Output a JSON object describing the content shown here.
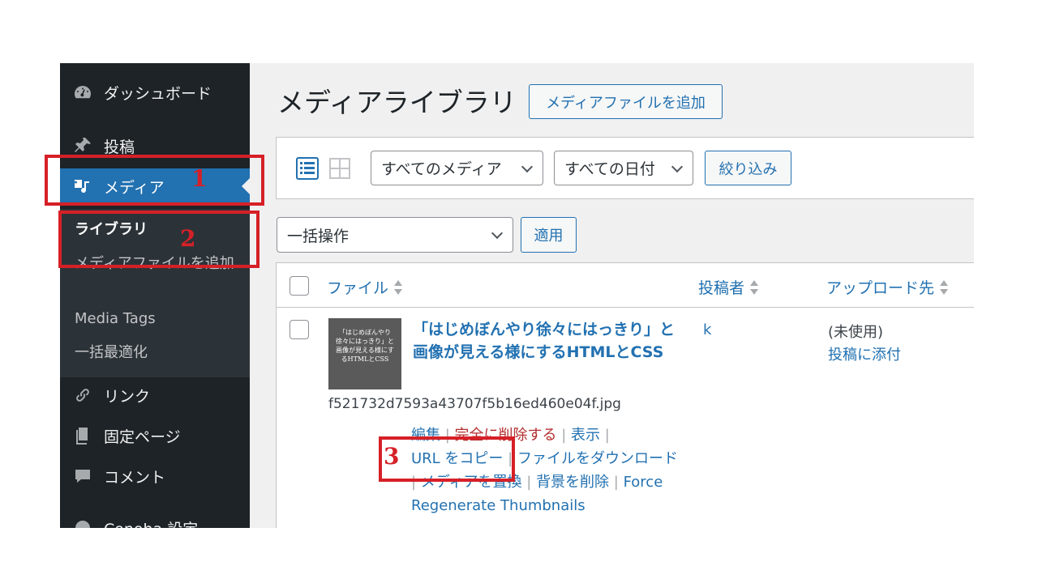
{
  "sidebar": {
    "items": [
      {
        "label": "ダッシュボード",
        "icon": "dashboard-icon"
      },
      {
        "label": "投稿",
        "icon": "pin-icon"
      },
      {
        "label": "メディア",
        "icon": "media-icon",
        "active": true
      },
      {
        "label": "リンク",
        "icon": "link-icon"
      },
      {
        "label": "固定ページ",
        "icon": "page-icon"
      },
      {
        "label": "コメント",
        "icon": "comment-icon"
      },
      {
        "label": "Conoha 設定",
        "icon": "settings-icon"
      }
    ],
    "submenu": [
      {
        "label": "ライブラリ",
        "current": true
      },
      {
        "label": "メディアファイルを追加"
      },
      {
        "label": "Media Tags"
      },
      {
        "label": "一括最適化"
      }
    ]
  },
  "header": {
    "title": "メディアライブラリ",
    "add_button": "メディアファイルを追加"
  },
  "filters": {
    "media_type": "すべてのメディア",
    "date": "すべての日付",
    "filter_button": "絞り込み"
  },
  "bulk": {
    "action": "一括操作",
    "apply_button": "適用"
  },
  "table": {
    "columns": {
      "file": "ファイル",
      "author": "投稿者",
      "uploaded_to": "アップロード先"
    },
    "row": {
      "thumb_text": "「はじめぼんやり徐々にはっきり」と画像が見える様にするHTMLとCSS",
      "title": "「はじめぼんやり徐々にはっきり」と画像が見える様にするHTMLとCSS",
      "filename": "f521732d7593a43707f5b16ed460e04f.jpg",
      "actions": {
        "edit": "編集",
        "delete": "完全に削除する",
        "view": "表示",
        "copy_url": "URL をコピー",
        "download": "ファイルをダウンロード",
        "replace": "メディアを置換",
        "remove_bg": "背景を削除",
        "regenerate": "Force Regenerate Thumbnails"
      },
      "author": "k",
      "uploaded_status": "(未使用)",
      "attach_link": "投稿に添付"
    }
  },
  "annotations": {
    "n1": "1",
    "n2": "2",
    "n3": "3"
  },
  "colors": {
    "accent": "#2271b1",
    "sidebar": "#1d2327",
    "annotation": "#d62027"
  }
}
